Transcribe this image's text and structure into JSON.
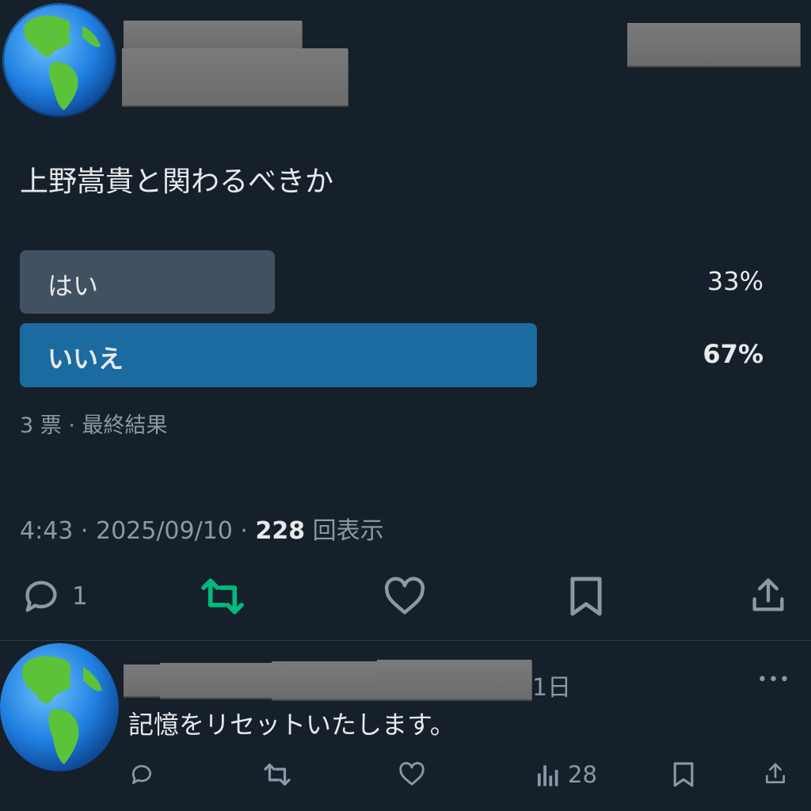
{
  "post": {
    "question": "上野嵩貴と関わるべきか",
    "poll": {
      "options": [
        {
          "label": "はい",
          "percent": "33%",
          "fraction": 0.33,
          "winner": false
        },
        {
          "label": "いいえ",
          "percent": "67%",
          "fraction": 0.67,
          "winner": true
        }
      ],
      "summary": "3 票 · 最終結果"
    },
    "meta": {
      "time_date": "4:43 · 2025/09/10 · ",
      "views_count": "228",
      "views_label": " 回表示"
    },
    "actions": {
      "reply_count": "1"
    }
  },
  "reply": {
    "time": "1日",
    "text": "記憶をリセットいたします。",
    "more_label": "•••",
    "views_count": "28"
  },
  "colors": {
    "background": "#16202b",
    "poll_bar": "#415161",
    "poll_winner": "#1b6aa0",
    "retweet_active": "#00ba7c",
    "muted": "#8b98a5"
  },
  "icons": {
    "avatar": "earth-americas-icon",
    "reply": "speech-bubble-icon",
    "retweet": "retweet-icon",
    "like": "heart-icon",
    "bookmark": "bookmark-icon",
    "share": "share-icon",
    "views": "bar-chart-icon"
  }
}
